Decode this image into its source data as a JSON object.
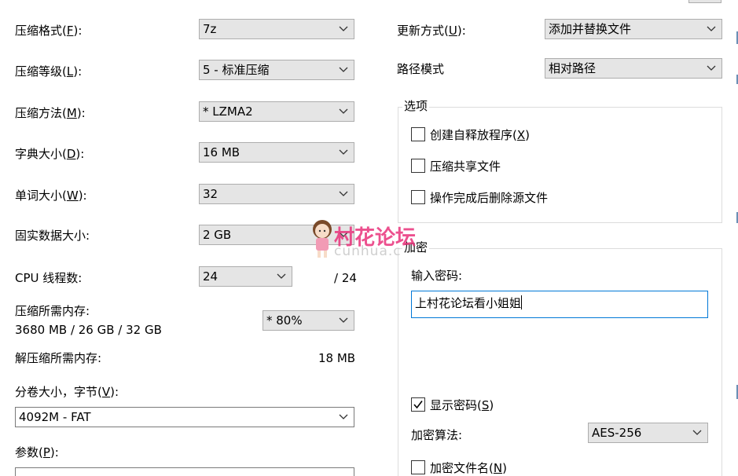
{
  "left": {
    "format": {
      "label": "压缩格式(",
      "key": "F",
      "suffix": "):",
      "value": "7z"
    },
    "level": {
      "label": "压缩等级(",
      "key": "L",
      "suffix": "):",
      "value": "5 - 标准压缩"
    },
    "method": {
      "label": "压缩方法(",
      "key": "M",
      "suffix": "):",
      "value": "*  LZMA2"
    },
    "dict": {
      "label": "字典大小(",
      "key": "D",
      "suffix": "):",
      "value": "16 MB"
    },
    "word": {
      "label": "单词大小(",
      "key": "W",
      "suffix": "):",
      "value": "32"
    },
    "solid": {
      "label": "固实数据大小:",
      "value": "2 GB"
    },
    "threads": {
      "label": "CPU 线程数:",
      "value": "24",
      "max": "/ 24"
    },
    "memory": {
      "label": "压缩所需内存:",
      "detail": "3680 MB / 26 GB / 32 GB",
      "value": "* 80%"
    },
    "decompress": {
      "label": "解压缩所需内存:",
      "value": "18 MB"
    },
    "volume": {
      "label": "分卷大小，字节(",
      "key": "V",
      "suffix": "):",
      "value": "4092M - FAT"
    },
    "params": {
      "label": "参数(",
      "key": "P",
      "suffix": "):"
    }
  },
  "right": {
    "update": {
      "label": "更新方式(",
      "key": "U",
      "suffix": "):",
      "value": "添加并替换文件"
    },
    "path": {
      "label": "路径模式",
      "value": "相对路径"
    },
    "options": {
      "title": "选项",
      "sfx": {
        "label": "创建自释放程序(",
        "key": "X",
        "suffix": ")",
        "checked": false
      },
      "shared": {
        "label": "压缩共享文件",
        "checked": false
      },
      "delete": {
        "label": "操作完成后删除源文件",
        "checked": false
      }
    },
    "encryption": {
      "title": "加密",
      "password_label": "输入密码:",
      "password_value": "上村花论坛看小姐姐",
      "show": {
        "label": "显示密码(",
        "key": "S",
        "suffix": ")",
        "checked": true
      },
      "method_label": "加密算法:",
      "method_value": "AES-256",
      "names": {
        "label": "加密文件名(",
        "key": "N",
        "suffix": ")",
        "checked": false
      }
    }
  },
  "watermark": {
    "title": "村花论坛",
    "subtitle": "cunhua.c"
  },
  "colors": {
    "combo_bg": "#e5e5e5",
    "focus_border": "#0078d7",
    "watermark": "#e9327b"
  }
}
